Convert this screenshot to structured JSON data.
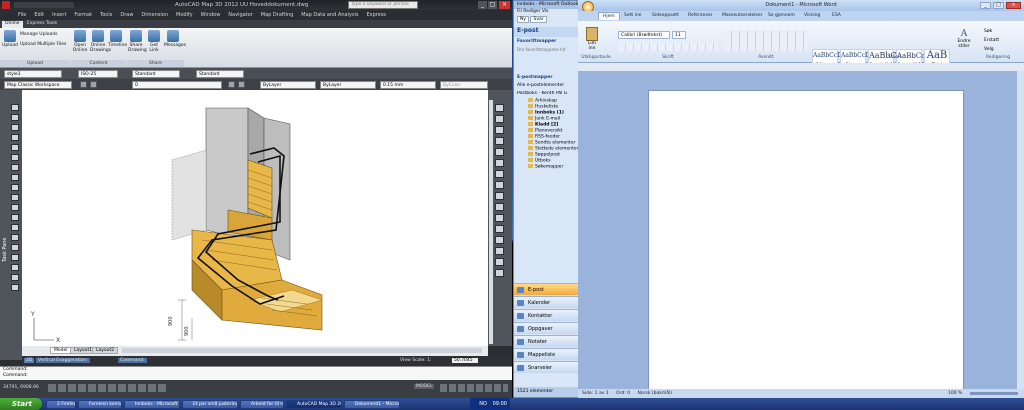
{
  "acad": {
    "title": "AutoCAD Map 3D 2012   UU Hoveddokument.dwg",
    "search_placeholder": "Type a keyword or phrase",
    "menus": [
      "File",
      "Edit",
      "Insert",
      "Format",
      "Tools",
      "Draw",
      "Dimension",
      "Modify",
      "Window",
      "Navigator",
      "Map Drafting",
      "Map Data and Analysis",
      "Express"
    ],
    "ribbon_tabs": [
      "Online",
      "Express Tools"
    ],
    "upload": {
      "manage": "Manage Uploads",
      "upload": "Upload",
      "multi": "Upload Multiple Files",
      "group": "Upload"
    },
    "content": {
      "open": "Open Online",
      "drawings": "Online Drawings",
      "timeline": "Timeline",
      "group": "Content"
    },
    "share": {
      "share": "Share Drawing",
      "link": "Get Link",
      "messages": "Messages",
      "group": "Share"
    },
    "style_combo": "style1",
    "dimstyle": "ISO-25",
    "standard1": "Standard",
    "standard2": "Standard",
    "workspace": "Map Classic Workspace",
    "layer": "0",
    "color": "ByLayer",
    "linetype": "ByLayer",
    "lineweight": "0.15 mm",
    "plotstyle": "ByColor",
    "task_pane": "Task Pane",
    "layout_tabs": [
      "Model",
      "Layout1",
      "Layout2"
    ],
    "status_items": [
      "2D",
      "Vertical Exaggeration:",
      "Command:"
    ],
    "view_scale": "View Scale: 1:",
    "view_scale_val": "50.7045",
    "cmd_line1": "Command:",
    "cmd_line2": "Command:",
    "coords": "34791, 6908.96",
    "model_label": "MODEL",
    "dims": [
      "900",
      "900"
    ]
  },
  "outlook": {
    "title": "Innboks - Microsoft Outlook",
    "menu": [
      "Fil",
      "Rediger",
      "Vis"
    ],
    "send_button": "Ny",
    "reply_button": "Svar",
    "heading": "E-post",
    "favorites": "Favorittmapper",
    "fav_hint": "Dra favorittmappene hit",
    "mail_folders": "E-postmapper",
    "all_items": "Alle e-postelementer",
    "mailbox": "Postboks - Kenth Pål G",
    "folders": [
      "Arkivskap",
      "Huskeliste",
      "Innboks",
      "Junk E-mail",
      "Kladd",
      "Planoversikt",
      "RSS-feeder",
      "Sendte elementer",
      "Slettede elementer",
      "Søppelpost",
      "Utboks",
      "Søkemapper"
    ],
    "folder_counts": {
      "2": "(1)",
      "4": "[2]"
    },
    "nav": [
      "E-post",
      "Kalender",
      "Kontakter",
      "Oppgaver",
      "Notater",
      "Mappeliste",
      "Snarveier"
    ],
    "status": "1521 elementer"
  },
  "word": {
    "title": "Dokument1 - Microsoft Word",
    "tabs": [
      "Hjem",
      "Sett inn",
      "Sideoppsett",
      "Referanser",
      "Masseutsendelser",
      "Se gjennom",
      "Visning",
      "ESA"
    ],
    "paste": "Lim inn",
    "font": "Calibri (Brødtekst)",
    "size": "11",
    "styles": [
      {
        "preview": "AaBbCcDc",
        "name": "¶ Normal"
      },
      {
        "preview": "AaBbCcDc",
        "name": "¶ Ingen m..."
      },
      {
        "preview": "AaBbC",
        "name": "Overskrift 1"
      },
      {
        "preview": "AaBbCc",
        "name": "Overskrift 2"
      },
      {
        "preview": "AaB",
        "name": "Tittel"
      }
    ],
    "change_styles": "Endre stiler",
    "edit_items": [
      "Søk",
      "Erstatt",
      "Velg"
    ],
    "groups": [
      "Utklippstavle",
      "Skrift",
      "Avsnitt",
      "Stiler",
      "Redigering"
    ],
    "status": [
      "Side: 1 av 1",
      "Ord: 0",
      "Norsk (bokmål)"
    ],
    "zoom": "100 %"
  },
  "taskbar": {
    "start": "Start",
    "tasks": [
      "2 Firefox",
      "Forelesn komvusve ...",
      "Innboks - Microsoft O...",
      "Et par små justeringe...",
      "Arbeid for til rom ...",
      "AutoCAD Map 3D 201...",
      "Dokument1 - Microsof..."
    ],
    "clock": "09:00",
    "lang": "NO"
  }
}
